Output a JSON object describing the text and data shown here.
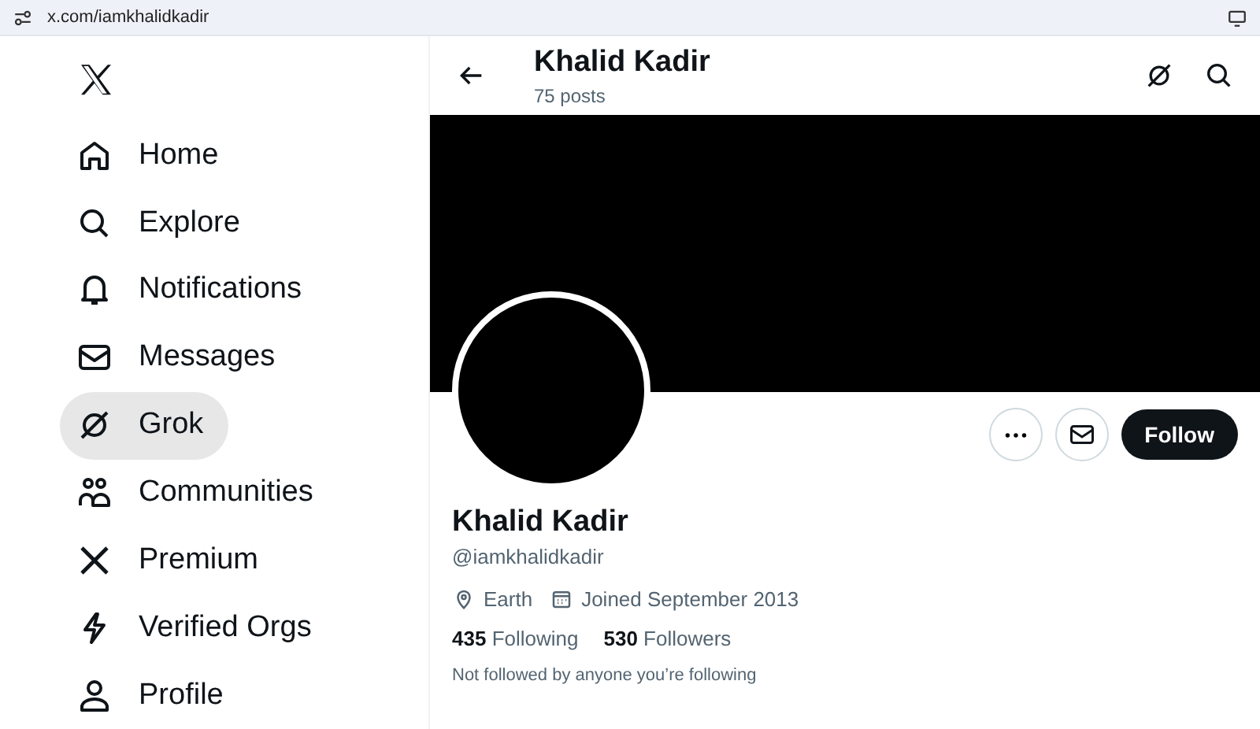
{
  "address_bar": {
    "url": "x.com/iamkhalidkadir"
  },
  "sidebar": {
    "items": [
      {
        "label": "Home",
        "selected": false
      },
      {
        "label": "Explore",
        "selected": false
      },
      {
        "label": "Notifications",
        "selected": false
      },
      {
        "label": "Messages",
        "selected": false
      },
      {
        "label": "Grok",
        "selected": true
      },
      {
        "label": "Communities",
        "selected": false
      },
      {
        "label": "Premium",
        "selected": false
      },
      {
        "label": "Verified Orgs",
        "selected": false
      },
      {
        "label": "Profile",
        "selected": false
      }
    ]
  },
  "header": {
    "title": "Khalid Kadir",
    "subtitle": "75 posts"
  },
  "profile": {
    "name": "Khalid Kadir",
    "handle": "@iamkhalidkadir",
    "location": "Earth",
    "joined": "Joined September 2013",
    "follow_button": "Follow",
    "stats": [
      {
        "count": "435",
        "label": "Following"
      },
      {
        "count": "530",
        "label": "Followers"
      }
    ],
    "note": "Not followed by anyone you’re following"
  }
}
